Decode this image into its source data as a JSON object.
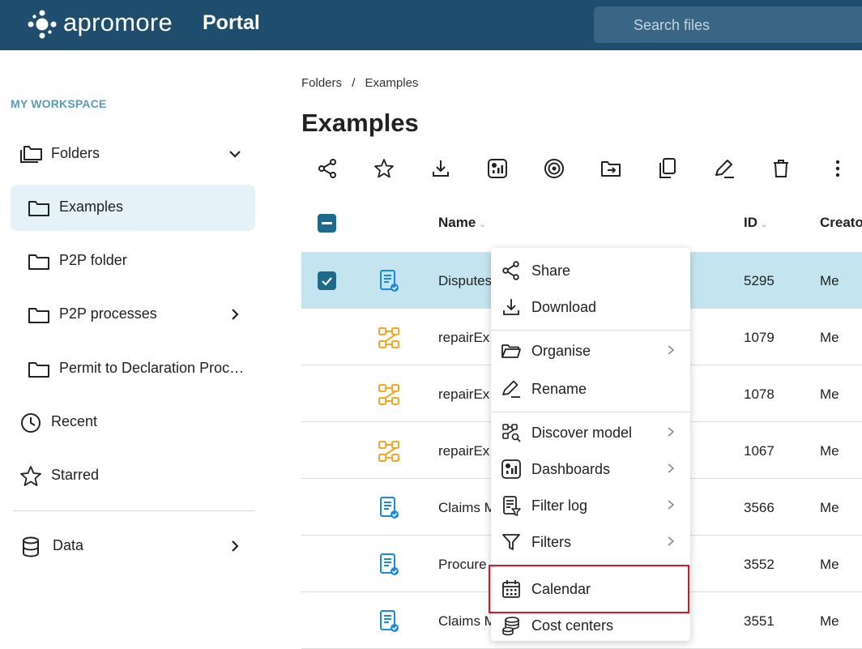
{
  "header": {
    "brand": "apromore",
    "product": "Portal",
    "search_placeholder": "Search files"
  },
  "sidebar": {
    "workspace_title": "MY WORKSPACE",
    "items": [
      {
        "label": "Folders",
        "icon": "folders-icon"
      },
      {
        "label": "Examples",
        "icon": "folder-icon",
        "active": true
      },
      {
        "label": "P2P folder",
        "icon": "folder-icon"
      },
      {
        "label": "P2P processes",
        "icon": "folder-icon"
      },
      {
        "label": "Permit to Declaration Proc…",
        "icon": "folder-icon"
      },
      {
        "label": "Recent",
        "icon": "clock-icon"
      },
      {
        "label": "Starred",
        "icon": "star-icon"
      },
      {
        "label": "Data",
        "icon": "database-icon"
      }
    ]
  },
  "main": {
    "breadcrumb": [
      "Folders",
      "/",
      "Examples"
    ],
    "title": "Examples",
    "toolbar": [
      "share-icon",
      "star-icon",
      "download-icon",
      "dashboard-icon",
      "discover-icon",
      "move-folder-icon",
      "copy-icon",
      "rename-icon",
      "delete-icon",
      "more-icon"
    ],
    "table": {
      "columns": [
        "Name",
        "ID",
        "Creato"
      ],
      "rows": [
        {
          "name": "Disputes",
          "id": "5295",
          "creator": "Me",
          "type": "log",
          "selected": true
        },
        {
          "name": "repairEx",
          "id": "1079",
          "creator": "Me",
          "type": "model"
        },
        {
          "name": "repairEx",
          "id": "1078",
          "creator": "Me",
          "type": "model"
        },
        {
          "name": "repairEx",
          "id": "1067",
          "creator": "Me",
          "type": "model"
        },
        {
          "name": "Claims M",
          "id": "3566",
          "creator": "Me",
          "type": "log"
        },
        {
          "name": "Procure",
          "id": "3552",
          "creator": "Me",
          "type": "log"
        },
        {
          "name": "Claims M",
          "id": "3551",
          "creator": "Me",
          "type": "log"
        }
      ]
    }
  },
  "context_menu": {
    "items": [
      {
        "label": "Share",
        "icon": "share-icon"
      },
      {
        "label": "Download",
        "icon": "download-icon"
      },
      {
        "label": "Organise",
        "icon": "folder-open-icon",
        "submenu": true
      },
      {
        "label": "Rename",
        "icon": "rename-icon"
      },
      {
        "label": "Discover model",
        "icon": "discover-model-icon",
        "submenu": true
      },
      {
        "label": "Dashboards",
        "icon": "dashboard-icon",
        "submenu": true
      },
      {
        "label": "Filter log",
        "icon": "filter-log-icon",
        "submenu": true
      },
      {
        "label": "Filters",
        "icon": "funnel-icon",
        "submenu": true
      },
      {
        "label": "Calendar",
        "icon": "calendar-icon",
        "highlighted": true
      },
      {
        "label": "Cost centers",
        "icon": "coins-icon"
      }
    ]
  },
  "colors": {
    "topbar": "#1e4d6e",
    "accent": "#1e6a8a",
    "selected_row": "#c4e5ef",
    "sidebar_active": "#e5f3f8",
    "log_icon": "#1a8ae0",
    "model_icon": "#f5a623",
    "highlight": "#e0141e"
  }
}
